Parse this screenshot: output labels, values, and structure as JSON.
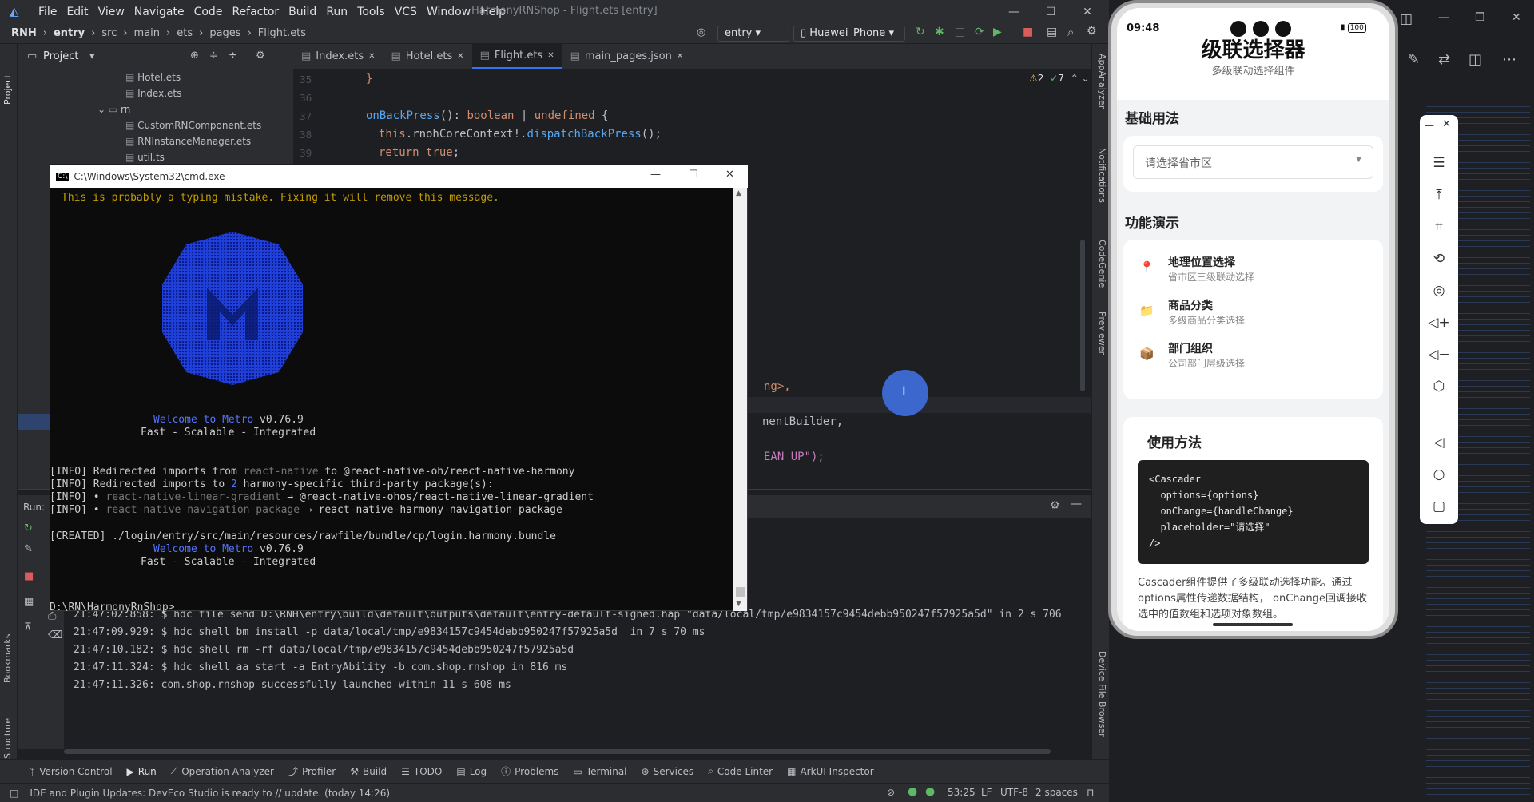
{
  "ide": {
    "menu": [
      "File",
      "Edit",
      "View",
      "Navigate",
      "Code",
      "Refactor",
      "Build",
      "Run",
      "Tools",
      "VCS",
      "Window",
      "Help"
    ],
    "window_title": "HarmonyRNShop - Flight.ets [entry]",
    "breadcrumb": [
      "RNH",
      "entry",
      "src",
      "main",
      "ets",
      "pages",
      "Flight.ets"
    ],
    "run_config": "entry",
    "device": "Huawei_Phone",
    "project_label": "Project",
    "tree": [
      {
        "label": "Hotel.ets",
        "indent": 2
      },
      {
        "label": "Index.ets",
        "indent": 2
      },
      {
        "label": "rn",
        "indent": 1
      },
      {
        "label": "CustomRNComponent.ets",
        "indent": 2
      },
      {
        "label": "RNInstanceManager.ets",
        "indent": 2
      },
      {
        "label": "util.ts",
        "indent": 2
      }
    ],
    "tabs": [
      "Index.ets",
      "Hotel.ets",
      "Flight.ets",
      "main_pages.json"
    ],
    "active_tab": "Flight.ets",
    "warnings": "2",
    "checks": "7",
    "line_numbers": [
      "35",
      "36",
      "37",
      "38",
      "39"
    ],
    "code": {
      "l35": "}",
      "l37_a": "onBackPress",
      "l37_b": "(): ",
      "l37_c": "boolean",
      "l37_d": " | ",
      "l37_e": "undefined",
      "l37_f": " {",
      "l38_a": "this",
      "l38_b": ".rnohCoreContext!.",
      "l38_c": "dispatchBackPress",
      "l38_d": "();",
      "l39_a": "return",
      "l39_b": " true",
      "l39_c": ";",
      "frag1": "ng>,",
      "frag2": "nentBuilder,",
      "frag3": "EAN_UP\");"
    },
    "run_label": "Run:",
    "run_log": [
      "21:47:02.858: $ hdc file send D:\\RNH\\entry\\build\\default\\outputs\\default\\entry-default-signed.hap \"data/local/tmp/e9834157c9454debb950247f57925a5d\" in 2 s 706",
      "21:47:09.929: $ hdc shell bm install -p data/local/tmp/e9834157c9454debb950247f57925a5d  in 7 s 70 ms",
      "21:47:10.182: $ hdc shell rm -rf data/local/tmp/e9834157c9454debb950247f57925a5d",
      "21:47:11.324: $ hdc shell aa start -a EntryAbility -b com.shop.rnshop in 816 ms",
      "21:47:11.326: com.shop.rnshop successfully launched within 11 s 608 ms"
    ],
    "bottom_tabs": [
      "Version Control",
      "Run",
      "Operation Analyzer",
      "Profiler",
      "Build",
      "TODO",
      "Log",
      "Problems",
      "Terminal",
      "Services",
      "Code Linter",
      "ArkUI Inspector"
    ],
    "status_message": "IDE and Plugin Updates: DevEco Studio is ready to // update. (today 14:26)",
    "status_right": [
      "53:25",
      "LF",
      "UTF-8",
      "2 spaces"
    ],
    "right_strip": [
      "AppAnalyzer",
      "Notifications",
      "CodeGenie",
      "Previewer",
      "Device File Browser"
    ],
    "left_strip": [
      "Project",
      "Bookmarks",
      "Structure"
    ]
  },
  "cmd": {
    "title": "C:\\Windows\\System32\\cmd.exe",
    "warning": "This is probably a typing mistake. Fixing it will remove this message.",
    "welcome1_a": "Welcome to Metro",
    "welcome1_b": " v0.76.9",
    "tagline": "Fast - Scalable - Integrated",
    "info1_a": "[INFO] Redirected imports from ",
    "info1_b": "react-native",
    "info1_c": " to @react-native-oh/react-native-harmony",
    "info2_a": "[INFO] Redirected imports to ",
    "info2_b": "2",
    "info2_c": " harmony-specific third-party package(s):",
    "info3_a": "[INFO] • ",
    "info3_b": "react-native-linear-gradient",
    "info3_c": " → @react-native-ohos/react-native-linear-gradient",
    "info4_a": "[INFO] • ",
    "info4_b": "react-native-navigation-package",
    "info4_c": " → react-native-harmony-navigation-package",
    "created": "[CREATED] ./login/entry/src/main/resources/rawfile/bundle/cp/login.harmony.bundle",
    "prompt": "D:\\RN\\HarmonyRnShop>"
  },
  "phone": {
    "time": "09:48",
    "battery": "100",
    "title": "级联选择器",
    "subtitle": "多级联动选择组件",
    "basic_title": "基础用法",
    "select_placeholder": "请选择省市区",
    "demo_title": "功能演示",
    "demos": [
      {
        "icon": "📍",
        "title": "地理位置选择",
        "desc": "省市区三级联动选择"
      },
      {
        "icon": "📁",
        "title": "商品分类",
        "desc": "多级商品分类选择"
      },
      {
        "icon": "📦",
        "title": "部门组织",
        "desc": "公司部门层级选择"
      }
    ],
    "usage_title": "使用方法",
    "code_lines": [
      "<Cascader",
      "  options={options}",
      "  onChange={handleChange}",
      "  placeholder=\"请选择\"",
      "/>"
    ],
    "usage_desc": "Cascader组件提供了多级联动选择功能。通过options属性传递数据结构， onChange回调接收选中的值数组和选项对象数组。"
  },
  "colors": {
    "accent": "#3574f0",
    "ide_bg": "#1e1f22",
    "panel_bg": "#2b2d30",
    "metro_blue": "#1f3fd6"
  }
}
